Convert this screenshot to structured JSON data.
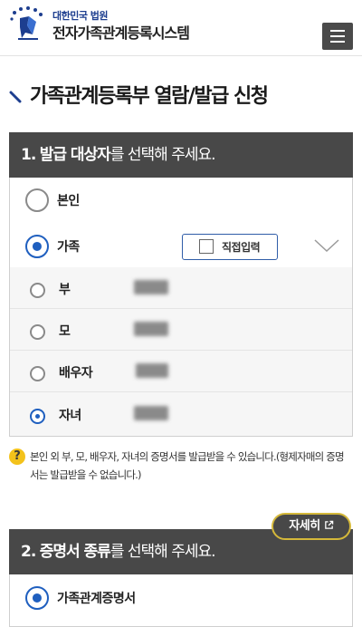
{
  "header": {
    "org_name": "대한민국 법원",
    "system_name": "전자가족관계등록시스템",
    "logo_icon": "court-logo-icon",
    "menu_icon": "hamburger-menu-icon"
  },
  "page": {
    "title": "가족관계등록부 열람/발급 신청"
  },
  "section1": {
    "heading_number": "1.",
    "heading_bold": "발급 대상자",
    "heading_rest": "를 선택해 주세요.",
    "options": [
      {
        "label": "본인",
        "selected": false
      },
      {
        "label": "가족",
        "selected": true
      }
    ],
    "direct_input_label": "직접입력",
    "family_members": [
      {
        "relation": "부",
        "selected": false
      },
      {
        "relation": "모",
        "selected": false
      },
      {
        "relation": "배우자",
        "selected": false
      },
      {
        "relation": "자녀",
        "selected": true
      }
    ]
  },
  "note": {
    "text": "본인 외 부, 모, 배우자, 자녀의 증명서를 발급받을 수 있습니다.(형제자매의 증명서는 발급받을 수 없습니다.)"
  },
  "detail_button": {
    "label": "자세히",
    "icon": "external-link-icon"
  },
  "section2": {
    "heading_number": "2.",
    "heading_bold": "증명서 종류",
    "heading_rest": "를 선택해 주세요.",
    "options": [
      {
        "label": "가족관계증명서",
        "selected": true
      }
    ]
  },
  "colors": {
    "section_header": "#484848",
    "accent_blue": "#1f5fbf",
    "help_yellow": "#f3c21b",
    "detail_border": "#d4b83a"
  }
}
